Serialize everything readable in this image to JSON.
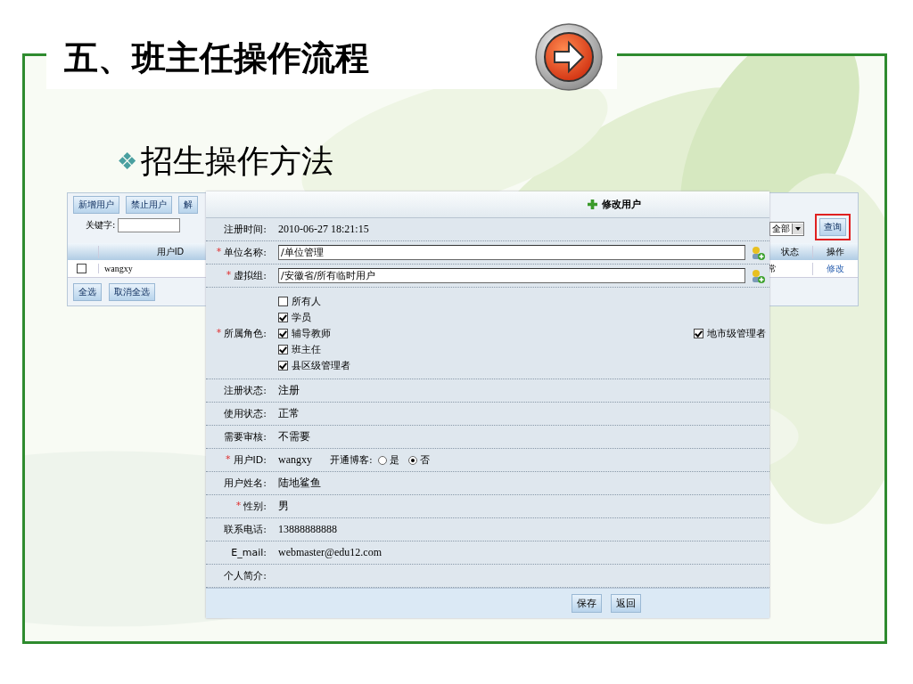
{
  "slide": {
    "title": "五、班主任操作流程",
    "bullet": "❖",
    "subtitle": "招生操作方法"
  },
  "user_list": {
    "toolbar_buttons": [
      "新增用户",
      "禁止用户",
      "解"
    ],
    "keyword_label": "关键字:",
    "status_filter": "全部",
    "query_button": {
      "label": "查询",
      "highlighted": true
    },
    "columns": [
      "用户ID",
      "状态",
      "操作"
    ],
    "rows": [
      {
        "checked": false,
        "user_id": "wangxy",
        "status": "常",
        "action": "修改"
      }
    ],
    "footer_buttons": [
      "全选",
      "取消全选"
    ]
  },
  "edit_form": {
    "title": "修改用户",
    "fields": [
      {
        "kind": "text",
        "label": "注册时间:",
        "value": "2010-06-27 18:21:15"
      },
      {
        "kind": "input",
        "marker": "*",
        "label": "单位名称:",
        "value": "/单位管理"
      },
      {
        "kind": "input",
        "marker": "*",
        "label": "虚拟组:",
        "value": "/安徽省/所有临时用户"
      },
      {
        "kind": "roles",
        "marker": "*",
        "label": "所属角色:",
        "options": [
          {
            "label": "所有人",
            "checked": false
          },
          {
            "label": "学员",
            "checked": true
          },
          {
            "label": "辅导教师",
            "checked": true
          },
          {
            "label": "班主任",
            "checked": true
          },
          {
            "label": "县区级管理者",
            "checked": true
          }
        ],
        "side_option": {
          "label": "地市级管理者",
          "checked": true
        }
      },
      {
        "kind": "text",
        "label": "注册状态:",
        "value": "注册"
      },
      {
        "kind": "text",
        "label": "使用状态:",
        "value": "正常"
      },
      {
        "kind": "text",
        "label": "需要审核:",
        "value": "不需要"
      },
      {
        "kind": "user_id",
        "marker": "*",
        "label": "用户ID:",
        "value": "wangxy",
        "blog_label": "开通博客:",
        "blog_options": [
          {
            "label": "是",
            "selected": false
          },
          {
            "label": "否",
            "selected": true
          }
        ]
      },
      {
        "kind": "text",
        "label": "用户姓名:",
        "value": "陆地鲨鱼"
      },
      {
        "kind": "text",
        "marker": "*",
        "label": "性别:",
        "value": "男"
      },
      {
        "kind": "text",
        "label": "联系电话:",
        "value": "13888888888"
      },
      {
        "kind": "text",
        "label": "E_mail:",
        "value": "webmaster@edu12.com"
      },
      {
        "kind": "text",
        "label": "个人简介:"
      }
    ],
    "buttons": [
      "保存",
      "返回"
    ]
  }
}
